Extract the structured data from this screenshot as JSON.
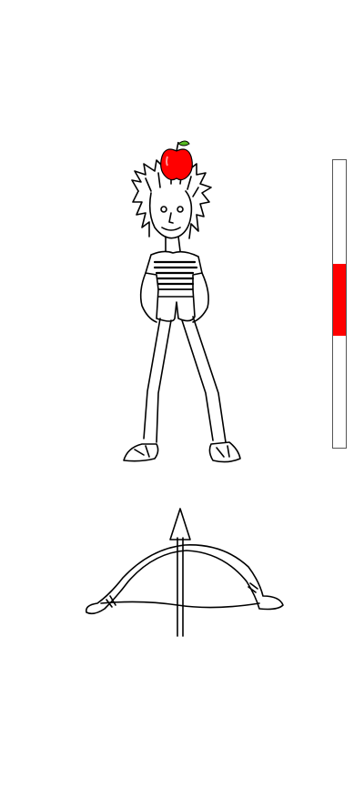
{
  "game": {
    "stage_background": "#ffffff",
    "line_color": "#000000",
    "apple_color": "#ff0000",
    "apple_leaf_color": "#55bb22",
    "meter": {
      "fill_color": "#ff0000",
      "border_color": "#555555",
      "zone_start": 0.36,
      "zone_end": 0.61
    },
    "icons": {
      "apple": "apple-icon",
      "bow": "bow-icon",
      "arrow": "arrow-icon",
      "person": "person-drawing"
    }
  }
}
